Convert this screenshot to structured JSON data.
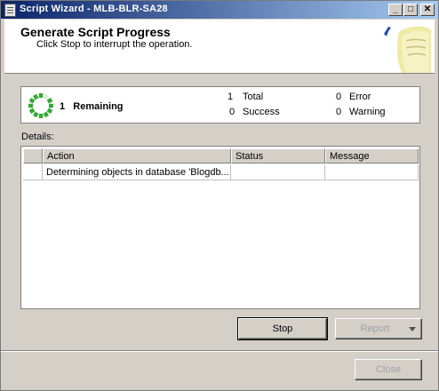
{
  "window": {
    "title": "Script Wizard - MLB-BLR-SA28",
    "minimize_glyph": "_",
    "maximize_glyph": "□",
    "close_glyph": "✕"
  },
  "header": {
    "title": "Generate Script Progress",
    "subtitle": "Click Stop to interrupt the operation."
  },
  "progress": {
    "remaining_count": "1",
    "remaining_label": "Remaining",
    "stats": [
      {
        "count": "1",
        "label": "Total"
      },
      {
        "count": "0",
        "label": "Success"
      },
      {
        "count": "0",
        "label": "Error"
      },
      {
        "count": "0",
        "label": "Warning"
      }
    ]
  },
  "details": {
    "label": "Details:",
    "columns": [
      "",
      "Action",
      "Status",
      "Message"
    ],
    "rows": [
      {
        "icon": "",
        "action": "Determining objects in database 'Blogdb...",
        "status": "",
        "message": ""
      }
    ]
  },
  "buttons": {
    "stop": "Stop",
    "report": "Report",
    "close": "Close"
  },
  "colors": {
    "titlebar_start": "#0a246a",
    "titlebar_end": "#a6caf0",
    "spinner": "#33aa33",
    "dialog_bg": "#d4d0c8"
  }
}
